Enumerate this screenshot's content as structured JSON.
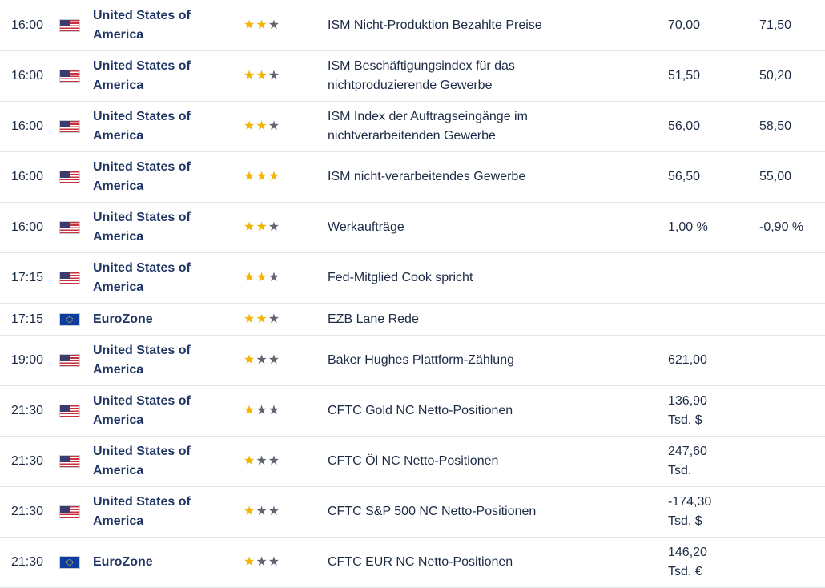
{
  "rows": [
    {
      "time": "16:00",
      "flag": "us-flag-icon",
      "country": [
        "United States of",
        "America"
      ],
      "stars": 2,
      "event": [
        "ISM Nicht-Produktion Bezahlte Preise"
      ],
      "actual": [
        "70,00"
      ],
      "forecast": "71,50"
    },
    {
      "time": "16:00",
      "flag": "us-flag-icon",
      "country": [
        "United States of",
        "America"
      ],
      "stars": 2,
      "event": [
        "ISM Beschäftigungsindex für das",
        "nichtproduzierende Gewerbe"
      ],
      "actual": [
        "51,50"
      ],
      "forecast": "50,20"
    },
    {
      "time": "16:00",
      "flag": "us-flag-icon",
      "country": [
        "United States of",
        "America"
      ],
      "stars": 2,
      "event": [
        "ISM Index der Auftragseingänge im",
        "nichtverarbeitenden Gewerbe"
      ],
      "actual": [
        "56,00"
      ],
      "forecast": "58,50"
    },
    {
      "time": "16:00",
      "flag": "us-flag-icon",
      "country": [
        "United States of",
        "America"
      ],
      "stars": 3,
      "event": [
        "ISM nicht-verarbeitendes Gewerbe"
      ],
      "actual": [
        "56,50"
      ],
      "forecast": "55,00"
    },
    {
      "time": "16:00",
      "flag": "us-flag-icon",
      "country": [
        "United States of",
        "America"
      ],
      "stars": 2,
      "event": [
        "Werkaufträge"
      ],
      "actual": [
        "1,00 %"
      ],
      "forecast": "-0,90 %"
    },
    {
      "time": "17:15",
      "flag": "us-flag-icon",
      "country": [
        "United States of",
        "America"
      ],
      "stars": 2,
      "event": [
        "Fed-Mitglied Cook spricht"
      ],
      "actual": [
        ""
      ],
      "forecast": ""
    },
    {
      "time": "17:15",
      "flag": "eu-flag-icon",
      "country": [
        "EuroZone"
      ],
      "stars": 2,
      "event": [
        "EZB Lane Rede"
      ],
      "actual": [
        ""
      ],
      "forecast": ""
    },
    {
      "time": "19:00",
      "flag": "us-flag-icon",
      "country": [
        "United States of",
        "America"
      ],
      "stars": 1,
      "event": [
        "Baker Hughes Plattform-Zählung"
      ],
      "actual": [
        "621,00"
      ],
      "forecast": ""
    },
    {
      "time": "21:30",
      "flag": "us-flag-icon",
      "country": [
        "United States of",
        "America"
      ],
      "stars": 1,
      "event": [
        "CFTC Gold NC Netto-Positionen"
      ],
      "actual": [
        "136,90",
        "Tsd. $"
      ],
      "forecast": ""
    },
    {
      "time": "21:30",
      "flag": "us-flag-icon",
      "country": [
        "United States of",
        "America"
      ],
      "stars": 1,
      "event": [
        "CFTC Öl NC Netto-Positionen"
      ],
      "actual": [
        "247,60",
        "Tsd."
      ],
      "forecast": ""
    },
    {
      "time": "21:30",
      "flag": "us-flag-icon",
      "country": [
        "United States of",
        "America"
      ],
      "stars": 1,
      "event": [
        "CFTC S&P 500 NC Netto-Positionen"
      ],
      "actual": [
        "-174,30",
        "Tsd. $"
      ],
      "forecast": ""
    },
    {
      "time": "21:30",
      "flag": "eu-flag-icon",
      "country": [
        "EuroZone"
      ],
      "stars": 1,
      "event": [
        "CFTC EUR NC Netto-Positionen"
      ],
      "actual": [
        "146,20",
        "Tsd. €"
      ],
      "forecast": ""
    }
  ],
  "colors": {
    "star_on": "#f4b400",
    "star_off": "#5f6670",
    "country": "#1f3664",
    "divider": "#e3e6ea"
  }
}
